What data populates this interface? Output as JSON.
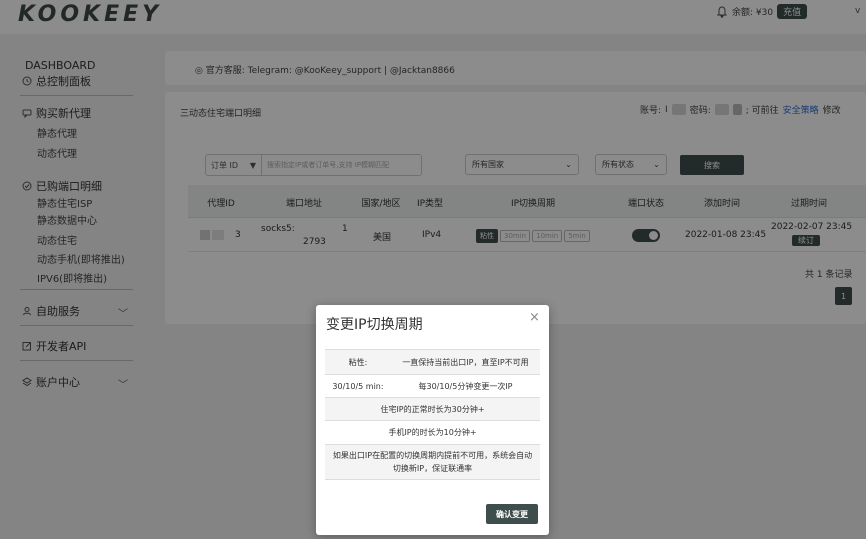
{
  "header": {
    "logo": "KOOKEEY",
    "balance_label": "余额: ¥30",
    "recharge_label": "充值",
    "user_caret": "v"
  },
  "sidebar": {
    "dashboard_en": "DASHBOARD",
    "dashboard_cn": "总控制面板",
    "buy_proxy": "购买新代理",
    "buy_items": [
      "静态代理",
      "动态代理"
    ],
    "purchased": "已购端口明细",
    "purchased_items": [
      "静态住宅ISP",
      "静态数据中心",
      "动态住宅",
      "动态手机(即将推出)",
      "IPV6(即将推出)"
    ],
    "self_service": "自助服务",
    "developer_api": "开发者API",
    "account_center": "账户中心"
  },
  "notice": {
    "text": "官方客服: Telegram: @KooKeey_support | @Jacktan8866"
  },
  "main": {
    "title": "三动态住宅端口明细",
    "acct_label": "账号:",
    "acct_value": "I",
    "pwd_label": "密码:",
    "goto_text": "; 可前往",
    "policy_link": "安全策略",
    "modify": "修改",
    "filter": {
      "select_label": "订单 ID",
      "placeholder": "搜索指定IP或者订单号,支持 IP模糊匹配",
      "country": "所有国家",
      "status": "所有状态",
      "search_label": "搜索"
    },
    "columns": [
      "代理ID",
      "端口地址",
      "国家/地区",
      "IP类型",
      "IP切换周期",
      "端口状态",
      "添加时间",
      "过期时间"
    ],
    "rows": [
      {
        "id": "3",
        "address_line1": "socks5:",
        "address_mid": "1",
        "address_line2": "2793",
        "country": "美国",
        "ip_type": "IPv4",
        "cycles": [
          "粘性",
          "30min",
          "10min",
          "5min"
        ],
        "added": "2022-01-08 23:45",
        "expires": "2022-02-07 23:45",
        "renew_label": "续订"
      }
    ],
    "total": "共 1 条记录",
    "page": "1"
  },
  "modal": {
    "title": "变更IP切换周期",
    "close": "×",
    "rows": [
      {
        "k": "粘性:",
        "v": "一直保持当前出口IP，直至IP不可用"
      },
      {
        "k": "30/10/5 min:",
        "v": "每30/10/5分钟变更一次IP"
      }
    ],
    "notes": [
      "住宅IP的正常时长为30分钟+",
      "手机IP的时长为10分钟+",
      "如果出口IP在配置的切换周期内提前不可用，系统会自动切换新IP，保证联通率"
    ],
    "confirm_label": "确认变更"
  },
  "colors": {
    "accent": "#3e4e4d",
    "link": "#2f6fd1"
  }
}
